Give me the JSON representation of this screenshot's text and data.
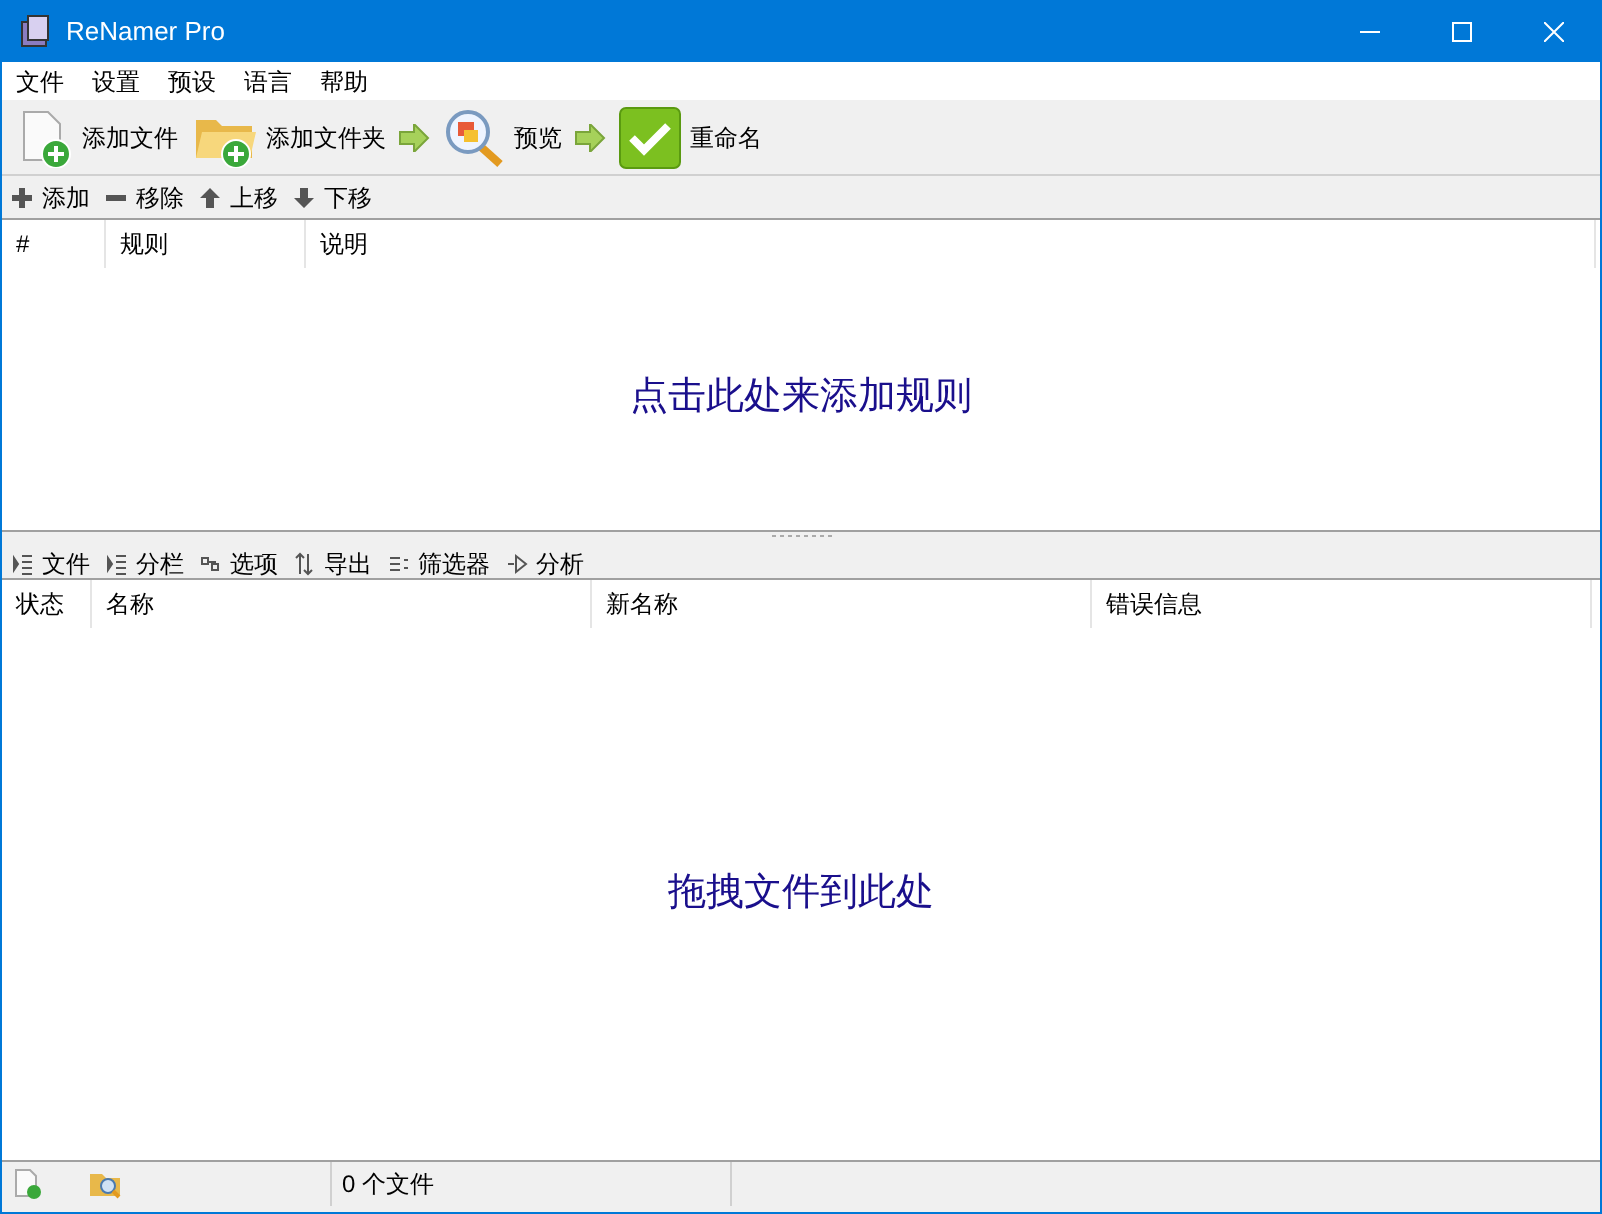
{
  "window": {
    "title": "ReNamer Pro"
  },
  "menu": [
    "文件",
    "设置",
    "预设",
    "语言",
    "帮助"
  ],
  "toolbar": [
    {
      "kind": "addfile",
      "label": "添加文件"
    },
    {
      "kind": "addfolder",
      "label": "添加文件夹"
    },
    {
      "kind": "arrow"
    },
    {
      "kind": "preview",
      "label": "预览"
    },
    {
      "kind": "arrow"
    },
    {
      "kind": "rename",
      "label": "重命名"
    }
  ],
  "rules_toolbar": [
    {
      "kind": "plus",
      "label": "添加"
    },
    {
      "kind": "minus",
      "label": "移除"
    },
    {
      "kind": "up",
      "label": "上移"
    },
    {
      "kind": "down",
      "label": "下移"
    }
  ],
  "rules_table": {
    "columns": [
      "#",
      "规则",
      "说明"
    ],
    "empty_hint": "点击此处来添加规则"
  },
  "files_toolbar": [
    {
      "kind": "list",
      "label": "文件"
    },
    {
      "kind": "list",
      "label": "分栏"
    },
    {
      "kind": "options",
      "label": "选项"
    },
    {
      "kind": "export",
      "label": "导出"
    },
    {
      "kind": "filter",
      "label": "筛选器"
    },
    {
      "kind": "analyze",
      "label": "分析"
    }
  ],
  "files_table": {
    "columns": [
      "状态",
      "名称",
      "新名称",
      "错误信息"
    ],
    "empty_hint": "拖拽文件到此处"
  },
  "status_bar": {
    "file_count": "0 个文件"
  }
}
